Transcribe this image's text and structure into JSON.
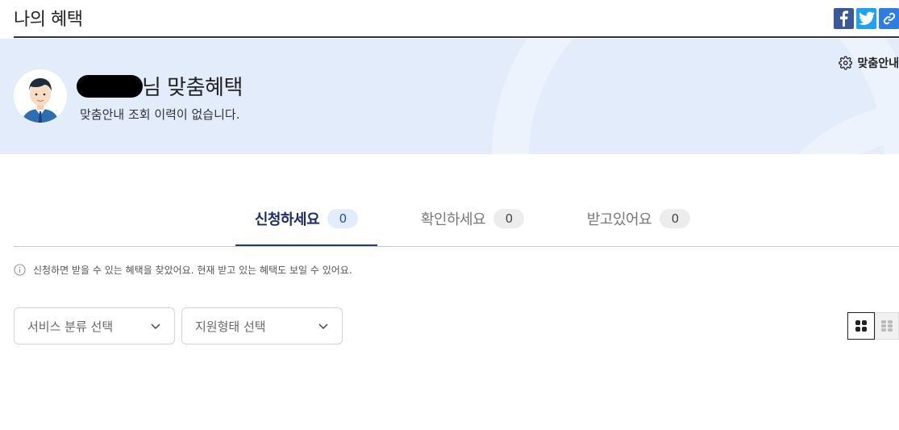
{
  "header": {
    "title": "나의 혜택",
    "share": {
      "facebook_icon": "facebook-icon",
      "twitter_icon": "twitter-icon",
      "link_icon": "link-icon"
    }
  },
  "banner": {
    "title_suffix": "님 맞춤혜택",
    "subtitle": "맞춤안내 조회 이력이 없습니다.",
    "settings_label": "맞춤안내",
    "colors": {
      "background": "#e3ecfb"
    }
  },
  "tabs": [
    {
      "label": "신청하세요",
      "count": "0",
      "active": true
    },
    {
      "label": "확인하세요",
      "count": "0",
      "active": false
    },
    {
      "label": "받고있어요",
      "count": "0",
      "active": false
    }
  ],
  "info_text": "신청하면 받을 수 있는 혜택을 찾았어요. 현재 받고 있는 혜택도 보일 수 있어요.",
  "filters": {
    "service_category": {
      "placeholder": "서비스 분류 선택"
    },
    "support_type": {
      "placeholder": "지원형태 선택"
    }
  },
  "colors": {
    "accent": "#1f3a8a",
    "active_tab_text": "#1a2c6b"
  }
}
